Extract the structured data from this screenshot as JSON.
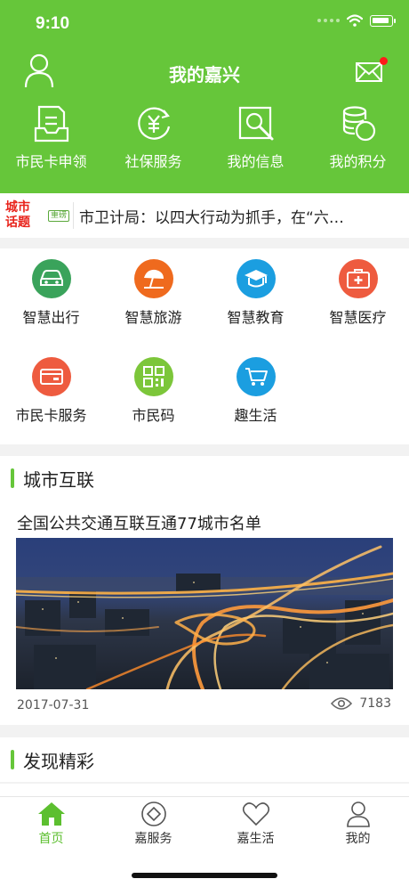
{
  "status": {
    "time": "9:10"
  },
  "header": {
    "title": "我的嘉兴",
    "quick_actions": [
      {
        "label": "市民卡申领",
        "icon": "card-apply-icon"
      },
      {
        "label": "社保服务",
        "icon": "social-security-icon"
      },
      {
        "label": "我的信息",
        "icon": "my-info-icon"
      },
      {
        "label": "我的积分",
        "icon": "points-icon"
      }
    ]
  },
  "ticker": {
    "tag_line1": "城市",
    "tag_line2": "话题",
    "badge": "重磅",
    "text": "市卫计局：以四大行动为抓手，在“六…"
  },
  "services": [
    {
      "label": "智慧出行",
      "icon": "car-icon",
      "color": "#3aa35b"
    },
    {
      "label": "智慧旅游",
      "icon": "umbrella-icon",
      "color": "#ef6a1e"
    },
    {
      "label": "智慧教育",
      "icon": "graduation-cap-icon",
      "color": "#1b9ee0"
    },
    {
      "label": "智慧医疗",
      "icon": "medical-kit-icon",
      "color": "#ee5b3f"
    },
    {
      "label": "市民卡服务",
      "icon": "card-icon",
      "color": "#ee5b3f"
    },
    {
      "label": "市民码",
      "icon": "qr-code-icon",
      "color": "#7cc63a"
    },
    {
      "label": "趣生活",
      "icon": "cart-icon",
      "color": "#1b9ee0"
    }
  ],
  "sections": {
    "city_connect": "城市互联",
    "discover": "发现精彩"
  },
  "news": {
    "title": "全国公共交通互联互通77城市名单",
    "date": "2017-07-31",
    "views": "7183"
  },
  "tabs": [
    {
      "label": "首页",
      "icon": "home-icon",
      "active": true
    },
    {
      "label": "嘉服务",
      "icon": "service-icon",
      "active": false
    },
    {
      "label": "嘉生活",
      "icon": "heart-icon",
      "active": false
    },
    {
      "label": "我的",
      "icon": "profile-icon",
      "active": false
    }
  ],
  "colors": {
    "brand_green": "#66c63a",
    "alert_red": "#e8231b"
  }
}
